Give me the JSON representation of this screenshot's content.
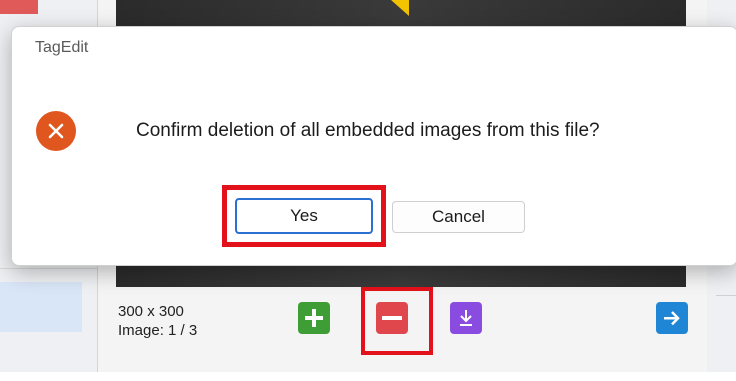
{
  "dialog": {
    "title": "TagEdit",
    "message": "Confirm deletion of all embedded images from this file?",
    "icon": "error-x-icon",
    "yes_label": "Yes",
    "cancel_label": "Cancel"
  },
  "image_info": {
    "dimensions": "300 x 300",
    "position": "Image: 1 / 3"
  },
  "toolbar": {
    "add_icon": "plus-icon",
    "remove_icon": "minus-icon",
    "save_icon": "download-icon",
    "next_icon": "arrow-right-icon"
  },
  "colors": {
    "add": "#3f9d35",
    "remove": "#e0474c",
    "save": "#8a4ce0",
    "next": "#1f86d6",
    "error_icon": "#e0561f",
    "highlight": "#e3121a",
    "focus": "#2c6fd2"
  }
}
